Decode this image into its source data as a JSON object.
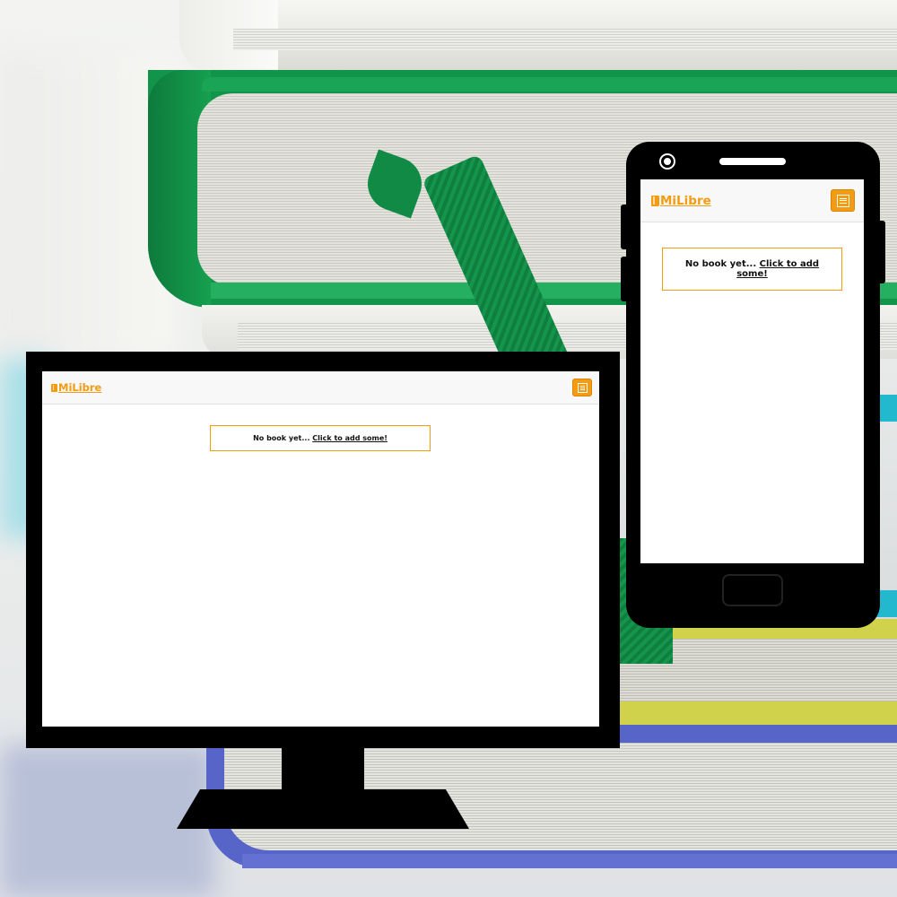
{
  "app": {
    "brand_name": "MiLibre",
    "brand_color": "#f39c12",
    "brand_icon": "book-icon",
    "menu_icon": "hamburger-menu-icon"
  },
  "library": {
    "empty_message": "No book yet...",
    "add_link_label": "Click to add some!"
  },
  "background": {
    "description_icon": "book-stack"
  }
}
